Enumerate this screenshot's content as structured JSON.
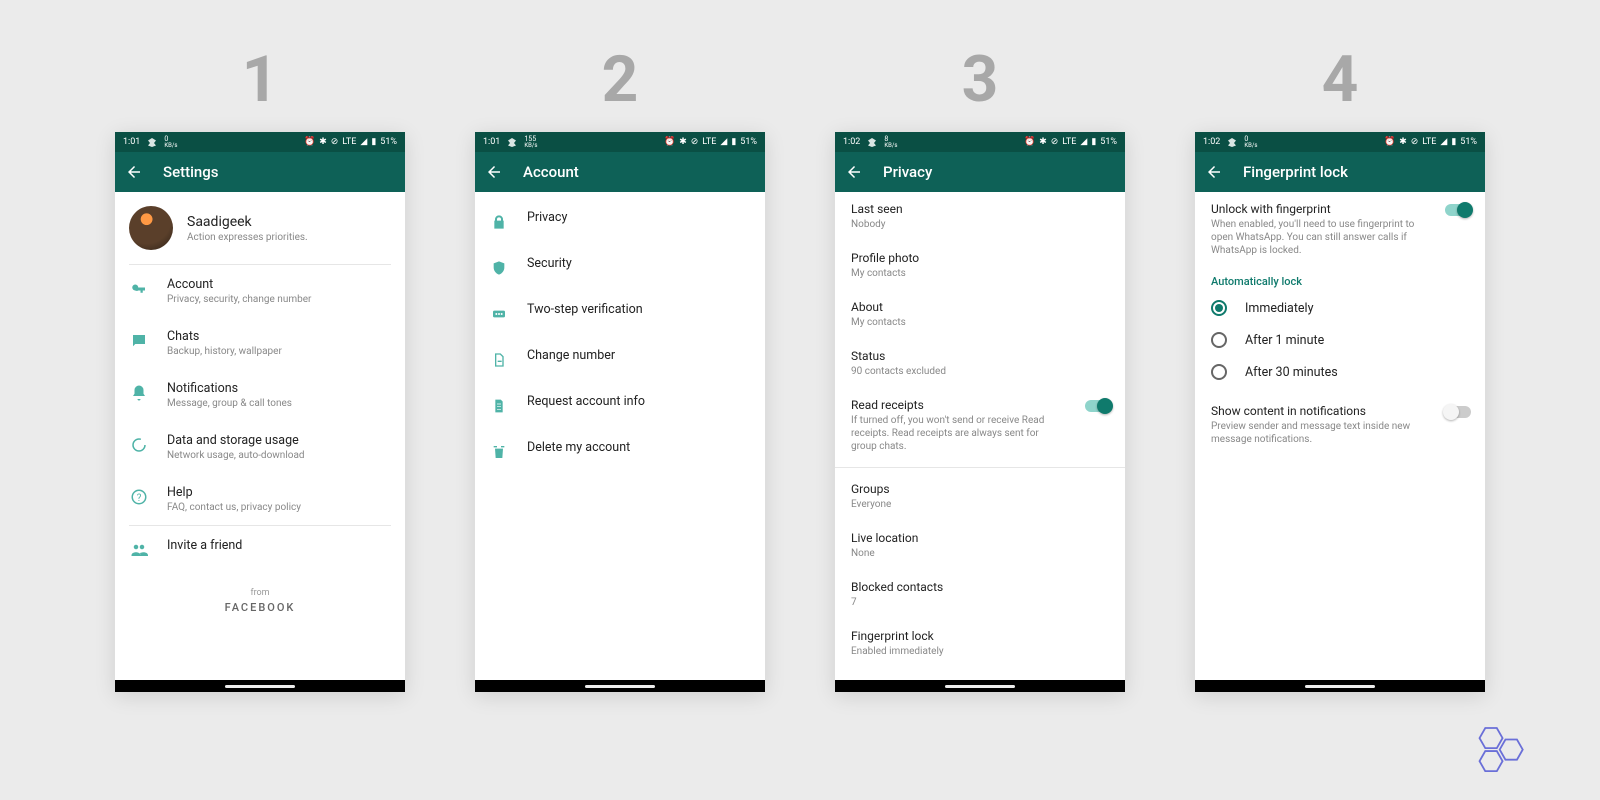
{
  "steps": [
    "1",
    "2",
    "3",
    "4"
  ],
  "status": {
    "times": [
      "1:01",
      "1:01",
      "1:02",
      "1:02"
    ],
    "speeds": [
      "0",
      "155",
      "8",
      "0"
    ],
    "speed_unit": "KB/s",
    "net": "LTE",
    "battery": "51%"
  },
  "s1": {
    "title": "Settings",
    "profile_name": "Saadigeek",
    "profile_sub": "Action expresses priorities.",
    "rows": [
      {
        "title": "Account",
        "sub": "Privacy, security, change number"
      },
      {
        "title": "Chats",
        "sub": "Backup, history, wallpaper"
      },
      {
        "title": "Notifications",
        "sub": "Message, group & call tones"
      },
      {
        "title": "Data and storage usage",
        "sub": "Network usage, auto-download"
      },
      {
        "title": "Help",
        "sub": "FAQ, contact us, privacy policy"
      },
      {
        "title": "Invite a friend",
        "sub": ""
      }
    ],
    "footer_from": "from",
    "footer_brand": "FACEBOOK"
  },
  "s2": {
    "title": "Account",
    "rows": [
      {
        "title": "Privacy"
      },
      {
        "title": "Security"
      },
      {
        "title": "Two-step verification"
      },
      {
        "title": "Change number"
      },
      {
        "title": "Request account info"
      },
      {
        "title": "Delete my account"
      }
    ]
  },
  "s3": {
    "title": "Privacy",
    "rows": [
      {
        "title": "Last seen",
        "sub": "Nobody"
      },
      {
        "title": "Profile photo",
        "sub": "My contacts"
      },
      {
        "title": "About",
        "sub": "My contacts"
      },
      {
        "title": "Status",
        "sub": "90 contacts excluded"
      },
      {
        "title": "Read receipts",
        "sub": "If turned off, you won't send or receive Read receipts. Read receipts are always sent for group chats."
      },
      {
        "title": "Groups",
        "sub": "Everyone"
      },
      {
        "title": "Live location",
        "sub": "None"
      },
      {
        "title": "Blocked contacts",
        "sub": "7"
      },
      {
        "title": "Fingerprint lock",
        "sub": "Enabled immediately"
      }
    ]
  },
  "s4": {
    "title": "Fingerprint lock",
    "unlock_title": "Unlock with fingerprint",
    "unlock_sub": "When enabled, you'll need to use fingerprint to open WhatsApp. You can still answer calls if WhatsApp is locked.",
    "autolock_header": "Automatically lock",
    "radios": [
      "Immediately",
      "After 1 minute",
      "After 30 minutes"
    ],
    "show_title": "Show content in notifications",
    "show_sub": "Preview sender and message text inside new message notifications."
  }
}
